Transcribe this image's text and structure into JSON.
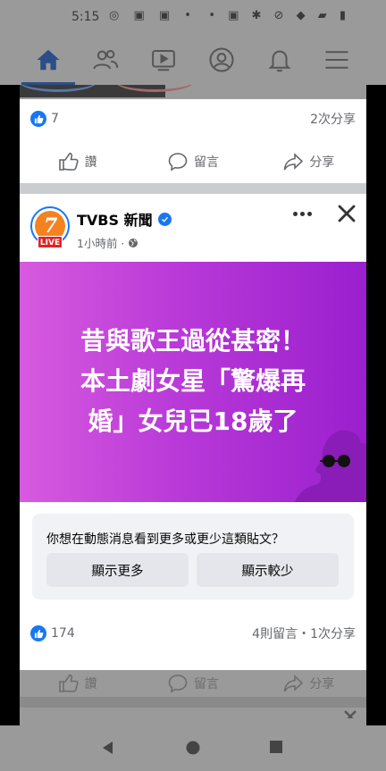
{
  "status_bar": {
    "time": "5:15"
  },
  "top_nav": {
    "tabs": [
      {
        "id": "home",
        "icon": "home-icon",
        "active": true
      },
      {
        "id": "friends",
        "icon": "friends-icon"
      },
      {
        "id": "watch",
        "icon": "watch-icon"
      },
      {
        "id": "profile",
        "icon": "profile-icon"
      },
      {
        "id": "notifications",
        "icon": "bell-icon"
      },
      {
        "id": "menu",
        "icon": "menu-icon"
      }
    ]
  },
  "post1": {
    "like_count": "7",
    "share_count": "2次分享",
    "actions": {
      "like": "讚",
      "comment": "留言",
      "share": "分享"
    }
  },
  "post2": {
    "page_name": "TVBS 新聞",
    "avatar_text": "7",
    "live_badge": "LIVE",
    "time_ago": "1小時前 ·",
    "headline": {
      "line1": "昔與歌王過從甚密！",
      "line2": "本土劇女星「驚爆再",
      "line3": "婚」女兒已18歲了"
    },
    "feedback": {
      "question": "你想在動態消息看到更多或更少這類貼文？",
      "show_more": "顯示更多",
      "show_less": "顯示較少"
    },
    "like_count": "174",
    "comments_shares": "4則留言・1次分享",
    "actions": {
      "like": "讚",
      "comment": "留言",
      "share": "分享"
    }
  },
  "colors": {
    "brand": "#1877f2",
    "banner_start": "#d75adf",
    "banner_end": "#9a1fce",
    "dim": "#9a9a9a"
  }
}
